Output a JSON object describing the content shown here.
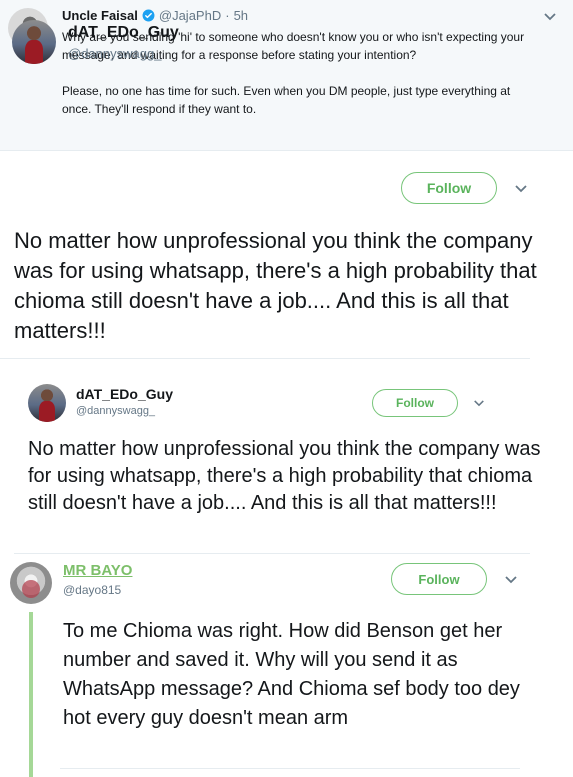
{
  "top_tweet": {
    "name": "Uncle Faisal",
    "handle": "@JajaPhD",
    "separator": "·",
    "time": "5h",
    "paragraph1": "Why are you sending 'hi' to someone who doesn't know you or who isn't expecting your message, and waiting for a response before stating your intention?",
    "paragraph2": "Please, no one has time for such. Even when you DM people, just type everything at once. They'll respond if they want to."
  },
  "tweet1": {
    "name": "dAT_EDo_Guy",
    "handle": "@dannyswagg_",
    "follow_label": "Follow",
    "text": "No matter how unprofessional you think the company was for using whatsapp, there's a high probability that chioma still doesn't have a job.... And this is all that matters!!!"
  },
  "tweet2": {
    "name": "dAT_EDo_Guy",
    "handle": "@dannyswagg_",
    "follow_label": "Follow",
    "text": "No matter how unprofessional you think the company was for using whatsapp, there's a high probability that chioma still doesn't have a job.... And this is all that matters!!!"
  },
  "tweet3": {
    "name": "MR BAYO",
    "handle": "@dayo815",
    "follow_label": "Follow",
    "text": "To me Chioma was right. How did Benson get her number and saved it. Why will you send it as WhatsApp message? And Chioma sef body too dey hot every guy doesn't mean arm"
  },
  "colors": {
    "follow_green": "#5ab35c",
    "verified_blue": "#1da1f2",
    "rail_green": "#a5d897"
  },
  "icons": [
    "verified-icon",
    "chevron-down-icon"
  ]
}
